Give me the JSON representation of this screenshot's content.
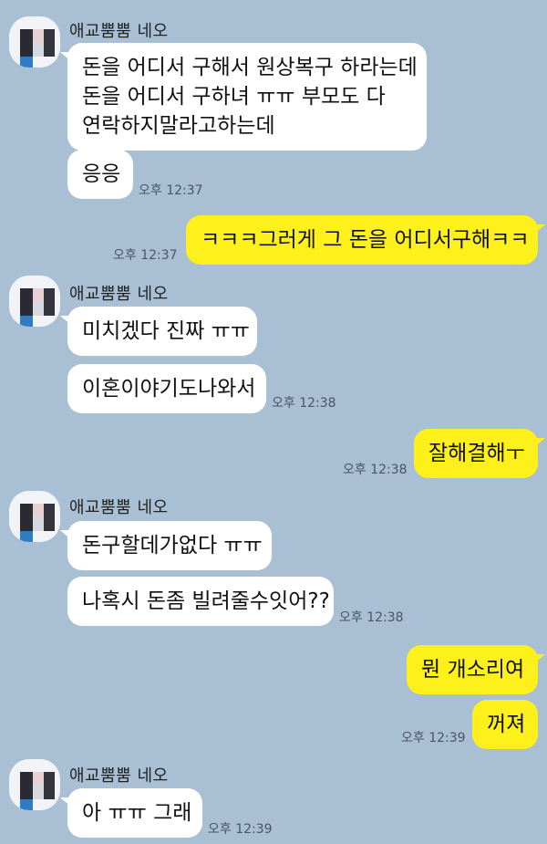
{
  "sender_name": "애교뿜뿜 네오",
  "messages": {
    "m1_line1": "돈을 어디서 구해서 원상복구 하라는데",
    "m1_line2": "돈을 어디서 구하녀 ㅠㅠ  부모도 다",
    "m1_line3": "연락하지말라고하는데",
    "m2": "응응",
    "t1": "오후 12:37",
    "m3": "ㅋㅋㅋ그러게 그 돈을 어디서구해ㅋㅋ",
    "t2": "오후 12:37",
    "m4": "미치겠다 진짜 ㅠㅠ",
    "m5": "이혼이야기도나와서",
    "t3": "오후 12:38",
    "m6": "잘해결해ㅜ",
    "t4": "오후 12:38",
    "m7": "돈구할데가없다 ㅠㅠ",
    "m8": "나혹시 돈좀 빌려줄수잇어??",
    "t5": "오후 12:38",
    "m9": "뭔 개소리여",
    "m10": "꺼져",
    "t6": "오후 12:39",
    "m11": "아 ㅠㅠ 그래",
    "t7": "오후 12:39"
  },
  "colors": {
    "background": "#a9bfd3",
    "incoming_bubble": "#ffffff",
    "outgoing_bubble": "#fef01b"
  }
}
